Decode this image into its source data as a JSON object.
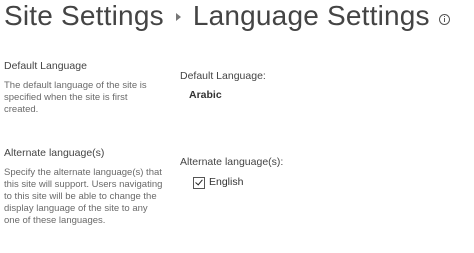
{
  "header": {
    "breadcrumb_parent": "Site Settings",
    "breadcrumb_current": "Language Settings"
  },
  "sections": {
    "default_language": {
      "title": "Default Language",
      "description": "The default language of the site is specified when the site is first created.",
      "field_label": "Default Language:",
      "value": "Arabic"
    },
    "alternate_languages": {
      "title": "Alternate language(s)",
      "description": "Specify the alternate language(s) that this site will support. Users navigating to this site will be able to change the display language of the site to any one of these languages.",
      "field_label": "Alternate language(s):",
      "options": [
        {
          "label": "English",
          "checked": true
        }
      ]
    }
  },
  "icons": {
    "breadcrumb_separator": "chevron-right-icon",
    "info": "info-icon"
  }
}
